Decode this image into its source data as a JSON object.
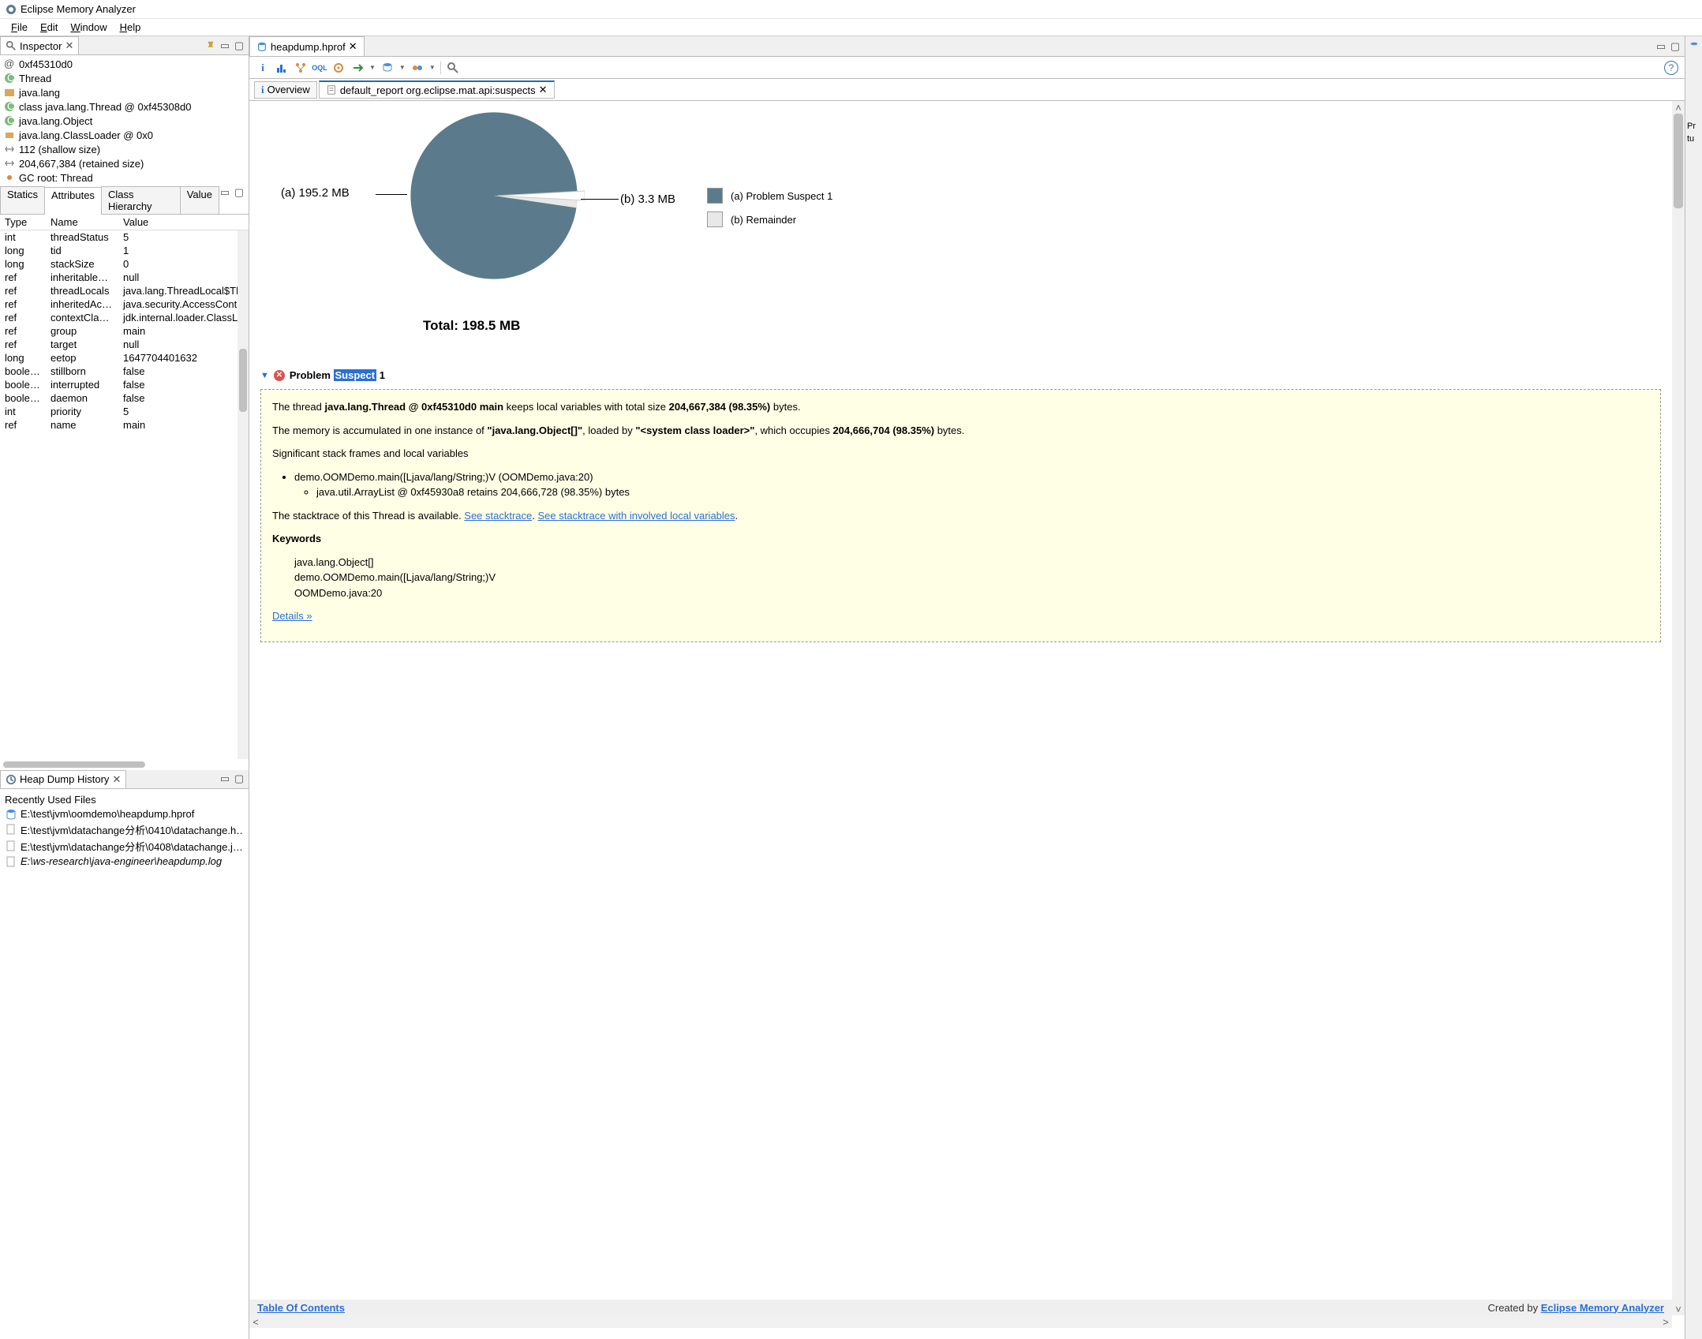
{
  "app": {
    "title": "Eclipse Memory Analyzer"
  },
  "menu": {
    "file": "File",
    "edit": "Edit",
    "window": "Window",
    "help": "Help"
  },
  "inspector": {
    "title": "Inspector",
    "rows": [
      {
        "icon": "address",
        "text": "0xf45310d0"
      },
      {
        "icon": "class",
        "text": "Thread"
      },
      {
        "icon": "package",
        "text": "java.lang"
      },
      {
        "icon": "class",
        "text": "class java.lang.Thread @ 0xf45308d0"
      },
      {
        "icon": "super",
        "text": "java.lang.Object"
      },
      {
        "icon": "loader",
        "text": "java.lang.ClassLoader @ 0x0"
      },
      {
        "icon": "size",
        "text": "112 (shallow size)"
      },
      {
        "icon": "size",
        "text": "204,667,384 (retained size)"
      },
      {
        "icon": "gc",
        "text": "GC root: Thread"
      }
    ],
    "tabfolder": {
      "statics": "Statics",
      "attributes": "Attributes",
      "classHierarchy": "Class Hierarchy",
      "value": "Value"
    },
    "attrHeaders": {
      "type": "Type",
      "name": "Name",
      "value": "Value"
    },
    "attributes": [
      {
        "type": "int",
        "name": "threadStatus",
        "value": "5"
      },
      {
        "type": "long",
        "name": "tid",
        "value": "1"
      },
      {
        "type": "long",
        "name": "stackSize",
        "value": "0"
      },
      {
        "type": "ref",
        "name": "inheritableT…",
        "value": "null"
      },
      {
        "type": "ref",
        "name": "threadLocals",
        "value": "java.lang.ThreadLocal$Th"
      },
      {
        "type": "ref",
        "name": "inheritedAcc…",
        "value": "java.security.AccessCont"
      },
      {
        "type": "ref",
        "name": "contextClass…",
        "value": "jdk.internal.loader.ClassL"
      },
      {
        "type": "ref",
        "name": "group",
        "value": "main"
      },
      {
        "type": "ref",
        "name": "target",
        "value": "null"
      },
      {
        "type": "long",
        "name": "eetop",
        "value": "1647704401632"
      },
      {
        "type": "boolean",
        "name": "stillborn",
        "value": "false"
      },
      {
        "type": "boolean",
        "name": "interrupted",
        "value": "false"
      },
      {
        "type": "boolean",
        "name": "daemon",
        "value": "false"
      },
      {
        "type": "int",
        "name": "priority",
        "value": "5"
      },
      {
        "type": "ref",
        "name": "name",
        "value": "main"
      }
    ]
  },
  "history": {
    "title": "Heap Dump History",
    "subtitle": "Recently Used Files",
    "files": [
      {
        "icon": "hprof",
        "text": "E:\\test\\jvm\\oomdemo\\heapdump.hprof",
        "italic": false
      },
      {
        "icon": "file",
        "text": "E:\\test\\jvm\\datachange分析\\0410\\datachange.h…",
        "italic": false
      },
      {
        "icon": "file",
        "text": "E:\\test\\jvm\\datachange分析\\0408\\datachange.j…",
        "italic": false
      },
      {
        "icon": "file",
        "text": "E:\\ws-research\\java-engineer\\heapdump.log",
        "italic": true
      }
    ]
  },
  "editor": {
    "tab": "heapdump.hprof",
    "page_overview": "Overview",
    "page_report": "default_report org.eclipse.mat.api:suspects"
  },
  "chart_data": {
    "type": "pie",
    "title": "Total: 198.5 MB",
    "series": [
      {
        "name": "(a)  Problem Suspect 1",
        "label": "(a)  195.2 MB",
        "value": 195.2,
        "color": "#5b7b8c"
      },
      {
        "name": "(b)  Remainder",
        "label": "(b)  3.3 MB",
        "value": 3.3,
        "color": "#e8e8e8"
      }
    ],
    "total": 198.5,
    "unit": "MB"
  },
  "suspect": {
    "heading_pre": "Problem ",
    "heading_hl": "Suspect",
    "heading_post": " 1",
    "p1_a": "The thread ",
    "p1_b": "java.lang.Thread @ 0xf45310d0 main",
    "p1_c": " keeps local variables with total size ",
    "p1_d": "204,667,384 (98.35%)",
    "p1_e": " bytes.",
    "p2_a": "The memory is accumulated in one instance of ",
    "p2_b": "\"java.lang.Object[]\"",
    "p2_c": ", loaded by ",
    "p2_d": "\"<system class loader>\"",
    "p2_e": ", which occupies ",
    "p2_f": "204,666,704 (98.35%)",
    "p2_g": " bytes.",
    "p3": "Significant stack frames and local variables",
    "li1": "demo.OOMDemo.main([Ljava/lang/String;)V (OOMDemo.java:20)",
    "li2": "java.util.ArrayList @ 0xf45930a8 retains 204,666,728 (98.35%) bytes",
    "p4_a": "The stacktrace of this Thread is available. ",
    "p4_link1": "See stacktrace",
    "p4_b": ". ",
    "p4_link2": "See stacktrace with involved local variables",
    "p4_c": ".",
    "keywords_label": "Keywords",
    "keywords": [
      "java.lang.Object[]",
      "demo.OOMDemo.main([Ljava/lang/String;)V",
      "OOMDemo.java:20"
    ],
    "details": "Details »"
  },
  "footer": {
    "toc": "Table Of Contents",
    "created_pre": "Created by ",
    "created_link": "Eclipse Memory Analyzer"
  },
  "rightbar": {
    "t1": "Pr",
    "t2": "tu"
  }
}
